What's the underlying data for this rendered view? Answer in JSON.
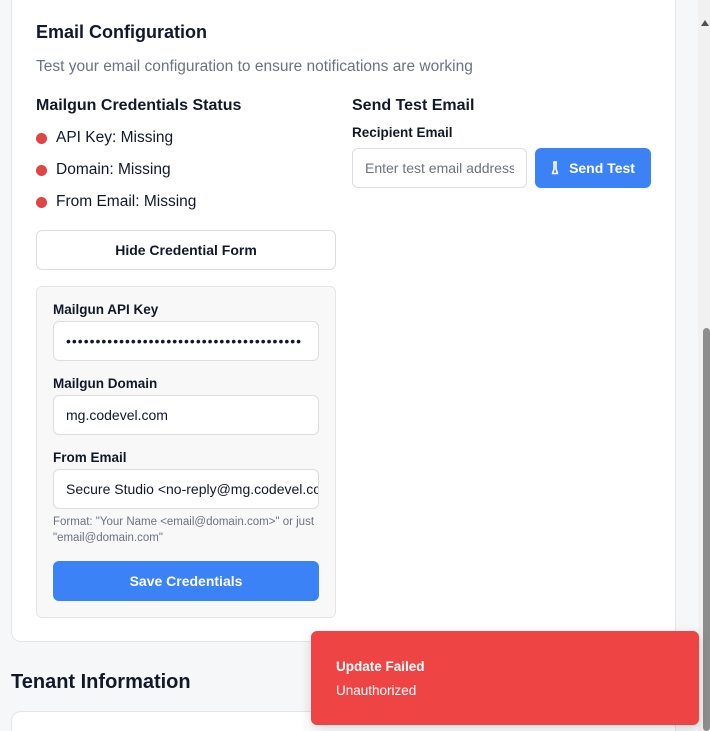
{
  "email_config": {
    "title": "Email Configuration",
    "description": "Test your email configuration to ensure notifications are working"
  },
  "credentials_status": {
    "title": "Mailgun Credentials Status",
    "items": [
      {
        "label": "API Key: Missing",
        "status_color": "#e04444"
      },
      {
        "label": "Domain: Missing",
        "status_color": "#e04444"
      },
      {
        "label": "From Email: Missing",
        "status_color": "#e04444"
      }
    ]
  },
  "credential_form": {
    "toggle_label": "Hide Credential Form",
    "api_key_label": "Mailgun API Key",
    "api_key_value": "••••••••••••••••••••••••••••••••••••••••",
    "domain_label": "Mailgun Domain",
    "domain_value": "mg.codevel.com",
    "from_email_label": "From Email",
    "from_email_value": "Secure Studio <no-reply@mg.codevel.com>",
    "hint": "Format: \"Your Name <email@domain.com>\" or just \"email@domain.com\"",
    "save_label": "Save Credentials"
  },
  "send_test": {
    "title": "Send Test Email",
    "recipient_label": "Recipient Email",
    "recipient_placeholder": "Enter test email address",
    "send_label": "Send Test",
    "icon": "flask-icon"
  },
  "tenant": {
    "title": "Tenant Information"
  },
  "toast": {
    "title": "Update Failed",
    "message": "Unauthorized",
    "color": "#ef4444"
  },
  "colors": {
    "accent": "#3b82f6",
    "error": "#ef4444"
  }
}
